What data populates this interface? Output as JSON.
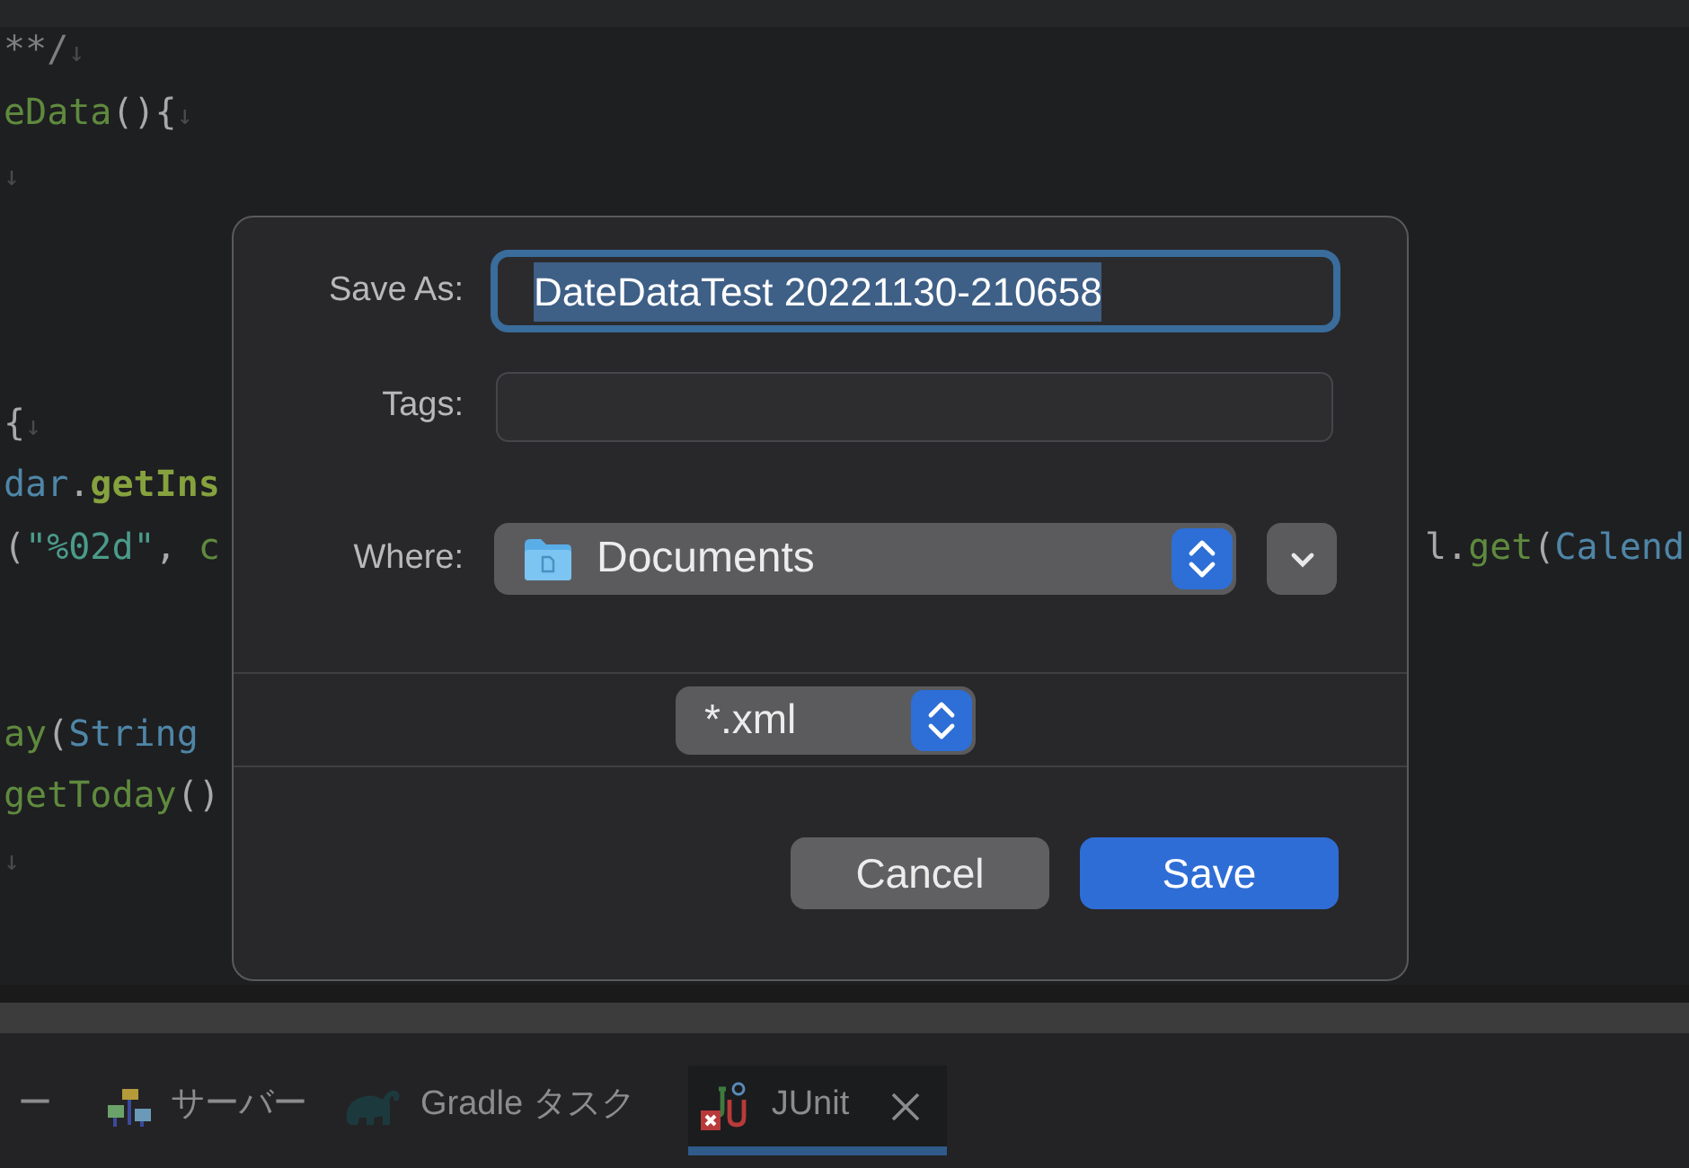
{
  "editor": {
    "left_lines": [
      {
        "segments": [
          {
            "text": "**/",
            "kind": "comment"
          },
          {
            "text": "↓",
            "kind": "marker"
          }
        ]
      },
      {
        "segments": [
          {
            "text": "eData",
            "kind": "method"
          },
          {
            "text": "(){",
            "kind": "punct"
          },
          {
            "text": "↓",
            "kind": "marker"
          }
        ]
      },
      {
        "segments": [
          {
            "text": "↓",
            "kind": "marker"
          }
        ]
      },
      {
        "segments": [
          {
            "text": "{",
            "kind": "punct"
          },
          {
            "text": "↓",
            "kind": "marker"
          }
        ]
      },
      {
        "segments": [
          {
            "text": "dar",
            "kind": "type"
          },
          {
            "text": ".",
            "kind": "punct"
          },
          {
            "text": "getIns",
            "kind": "method-bold"
          }
        ]
      },
      {
        "segments": [
          {
            "text": "(",
            "kind": "punct"
          },
          {
            "text": "\"%02d\"",
            "kind": "string"
          },
          {
            "text": ", ",
            "kind": "punct"
          },
          {
            "text": "c",
            "kind": "method"
          }
        ]
      },
      {
        "segments": [
          {
            "text": "ay",
            "kind": "method"
          },
          {
            "text": "(",
            "kind": "punct"
          },
          {
            "text": "String",
            "kind": "type"
          }
        ]
      },
      {
        "segments": [
          {
            "text": "getToday",
            "kind": "method"
          },
          {
            "text": "()",
            "kind": "punct"
          }
        ]
      },
      {
        "segments": [
          {
            "text": "↓",
            "kind": "marker"
          }
        ]
      }
    ],
    "right_line": {
      "segments": [
        {
          "text": "l.",
          "kind": "punct"
        },
        {
          "text": "get",
          "kind": "method"
        },
        {
          "text": "(",
          "kind": "punct"
        },
        {
          "text": "Calend",
          "kind": "type"
        }
      ]
    }
  },
  "dialog": {
    "save_as": {
      "label": "Save As:",
      "value": "DateDataTest 20221130-210658",
      "focused": true
    },
    "tags": {
      "label": "Tags:"
    },
    "where": {
      "label": "Where:",
      "value": "Documents"
    },
    "format": {
      "value": "*.xml"
    },
    "buttons": [
      {
        "label": "Cancel",
        "kind": "secondary"
      },
      {
        "label": "Save",
        "kind": "primary"
      }
    ]
  },
  "bottom_tabs": [
    {
      "label": "ー",
      "selected": false
    },
    {
      "label": "サーバー",
      "selected": false
    },
    {
      "label": "Gradle タスク",
      "selected": false
    },
    {
      "label": "JUnit",
      "selected": true
    }
  ]
}
